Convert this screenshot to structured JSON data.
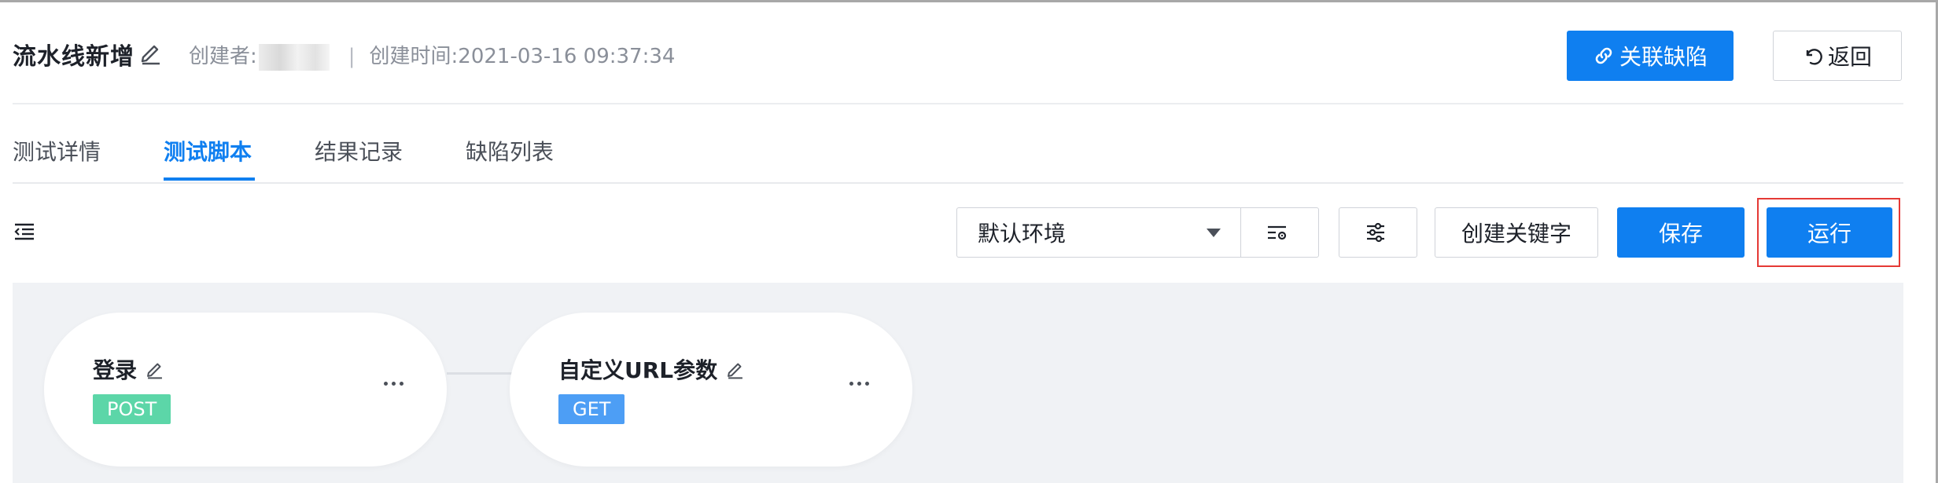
{
  "header": {
    "title": "流水线新增",
    "creator_label": "创建者:",
    "created_time": "创建时间:2021-03-16 09:37:34",
    "link_defect_button": "关联缺陷",
    "back_button": "返回"
  },
  "tabs": [
    {
      "label": "测试详情",
      "active": false
    },
    {
      "label": "测试脚本",
      "active": true
    },
    {
      "label": "结果记录",
      "active": false
    },
    {
      "label": "缺陷列表",
      "active": false
    }
  ],
  "toolbar": {
    "environment_selected": "默认环境",
    "create_keyword_button": "创建关键字",
    "save_button": "保存",
    "run_button": "运行"
  },
  "nodes": [
    {
      "name": "登录",
      "method": "POST",
      "method_color": "#5cd6a8"
    },
    {
      "name": "自定义URL参数",
      "method": "GET",
      "method_color": "#4d9ef5"
    }
  ],
  "colors": {
    "primary": "#0f7ff0",
    "highlight_border": "#e53935",
    "canvas_bg": "#f0f2f5"
  },
  "icons": {
    "title_edit": "pencil-icon",
    "link": "link-icon",
    "back": "undo-icon",
    "collapse": "collapse-panel-icon",
    "env_settings": "list-settings-icon",
    "filter": "sliders-icon",
    "node_edit": "pencil-icon",
    "node_more": "ellipsis-icon"
  }
}
